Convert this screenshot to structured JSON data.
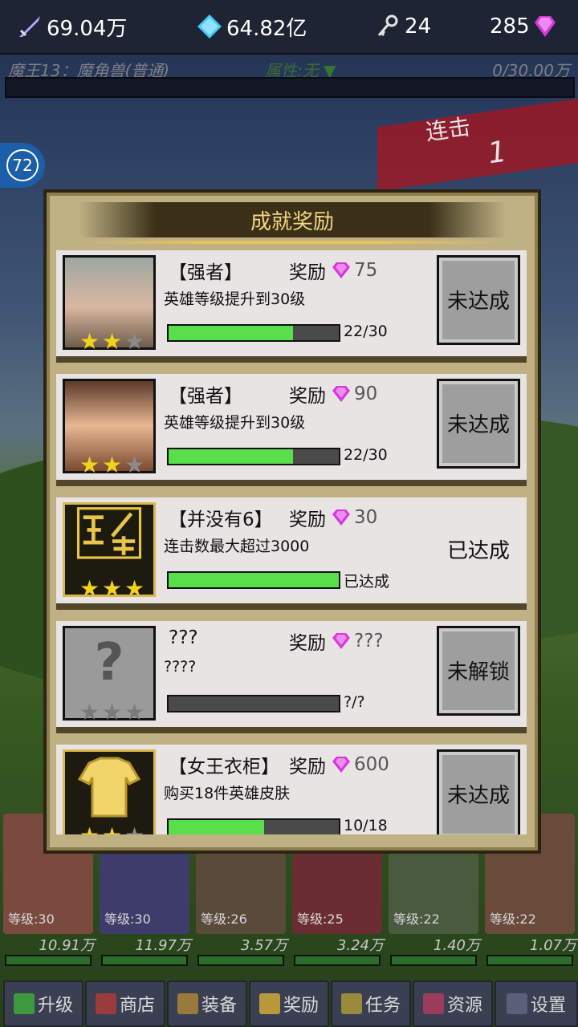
{
  "topbar": {
    "sword": "69.04万",
    "diamond": "64.82亿",
    "key": "24",
    "gem": "285"
  },
  "boss": {
    "name": "魔王13：魔角兽(普通)",
    "attribute": "属性:无",
    "hp": "0/30.00万"
  },
  "combo": {
    "label": "连击",
    "count": "1"
  },
  "level_badge": "72",
  "heroes": [
    {
      "level": "等级:30",
      "power": "10.91万"
    },
    {
      "level": "等级:30",
      "power": "11.97万"
    },
    {
      "level": "等级:26",
      "power": "3.57万"
    },
    {
      "level": "等级:25",
      "power": "3.24万"
    },
    {
      "level": "等级:22",
      "power": "1.40万"
    },
    {
      "level": "等级:22",
      "power": "1.07万"
    }
  ],
  "nav": [
    {
      "label": "升级",
      "icon": "arrow-up-icon"
    },
    {
      "label": "商店",
      "icon": "shop-icon"
    },
    {
      "label": "装备",
      "icon": "sword-icon"
    },
    {
      "label": "奖励",
      "icon": "trophy-icon"
    },
    {
      "label": "任务",
      "icon": "torch-icon"
    },
    {
      "label": "资源",
      "icon": "house-icon"
    },
    {
      "label": "设置",
      "icon": "screen-icon"
    }
  ],
  "modal": {
    "title": "成就奖励",
    "reward_label": "奖励",
    "achievements": [
      {
        "title": "【强者】",
        "reward": "75",
        "desc": "英雄等级提升到30级",
        "progress_text": "22/30",
        "progress": 0.73,
        "stars_filled": 2,
        "button": "未达成",
        "portrait": "hero-portrait-silver"
      },
      {
        "title": "【强者】",
        "reward": "90",
        "desc": "英雄等级提升到30级",
        "progress_text": "22/30",
        "progress": 0.73,
        "stars_filled": 2,
        "button": "未达成",
        "portrait": "hero-portrait-brown"
      },
      {
        "title": "【并没有6】",
        "reward": "30",
        "desc": "连击数最大超过3000",
        "progress_text": "已达成",
        "progress": 1.0,
        "stars_filled": 3,
        "button": "已达成",
        "portrait": "combo-icon"
      },
      {
        "title": "???",
        "reward": "???",
        "desc": "????",
        "progress_text": "?/?",
        "progress": 0.0,
        "stars_filled": 0,
        "button": "未解锁",
        "portrait": "question-icon"
      },
      {
        "title": "【女王衣柜】",
        "reward": "600",
        "desc": "购买18件英雄皮肤",
        "progress_text": "10/18",
        "progress": 0.56,
        "stars_filled": 2,
        "button": "未达成",
        "portrait": "clothes-icon"
      }
    ]
  },
  "colors": {
    "progress_green": "#58e04a",
    "gem_pink": "#d43ad8",
    "title_gold": "#f4d783"
  }
}
